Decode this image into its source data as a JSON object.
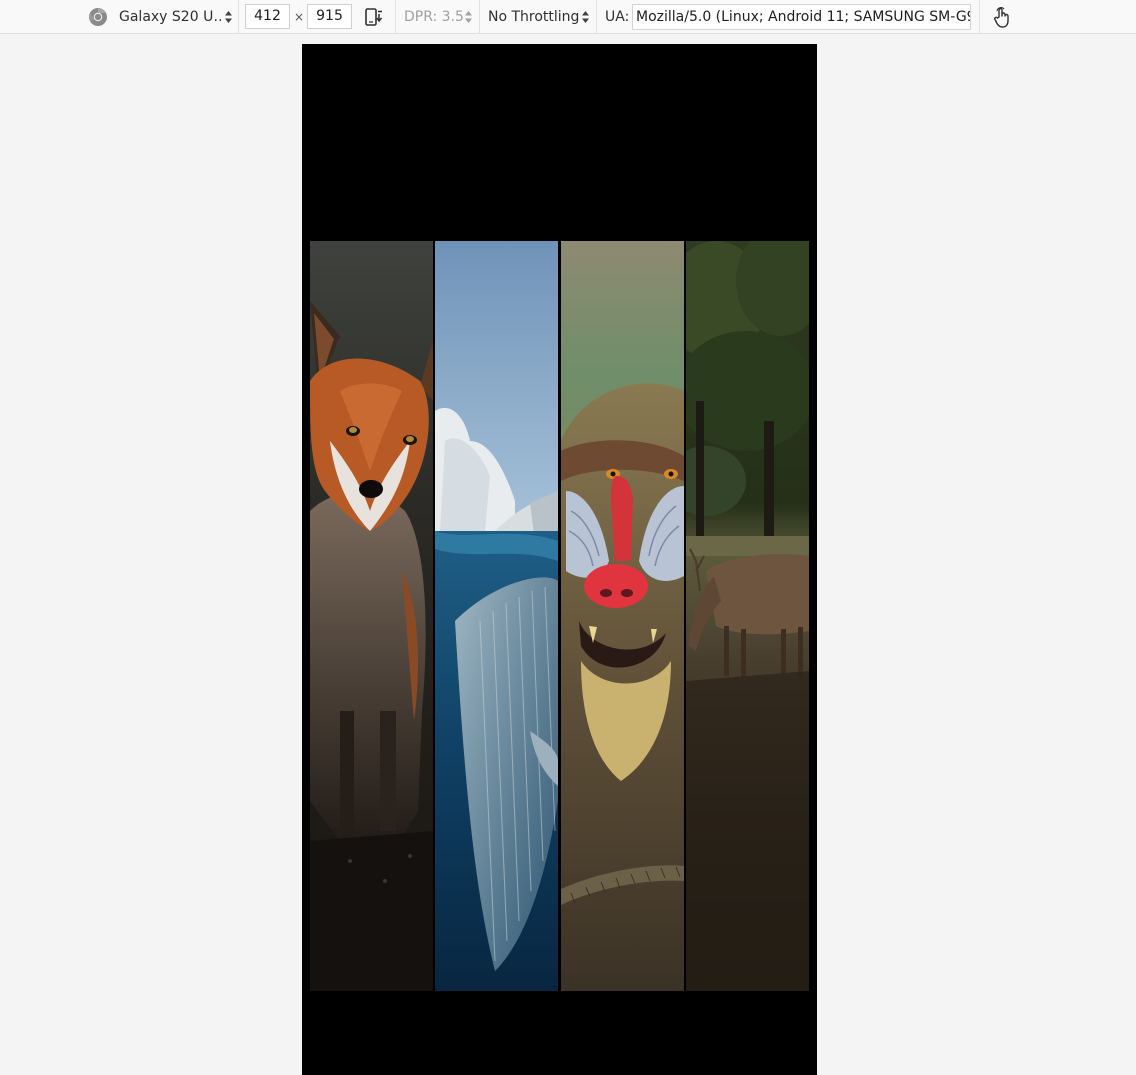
{
  "toolbar": {
    "device": "Galaxy S20 U…",
    "width": "412",
    "times": "×",
    "height": "915",
    "dpr": "DPR: 3.5",
    "throttling": "No Throttling",
    "ua_label": "UA:",
    "user_agent": "Mozilla/5.0 (Linux; Android 11; SAMSUNG SM-G97",
    "icons": [
      "chrome-icon",
      "rotate-icon",
      "touch-icon"
    ]
  },
  "viewport": {
    "background": "#000000",
    "panels": [
      "fox",
      "whale",
      "mandrill",
      "deer"
    ]
  }
}
